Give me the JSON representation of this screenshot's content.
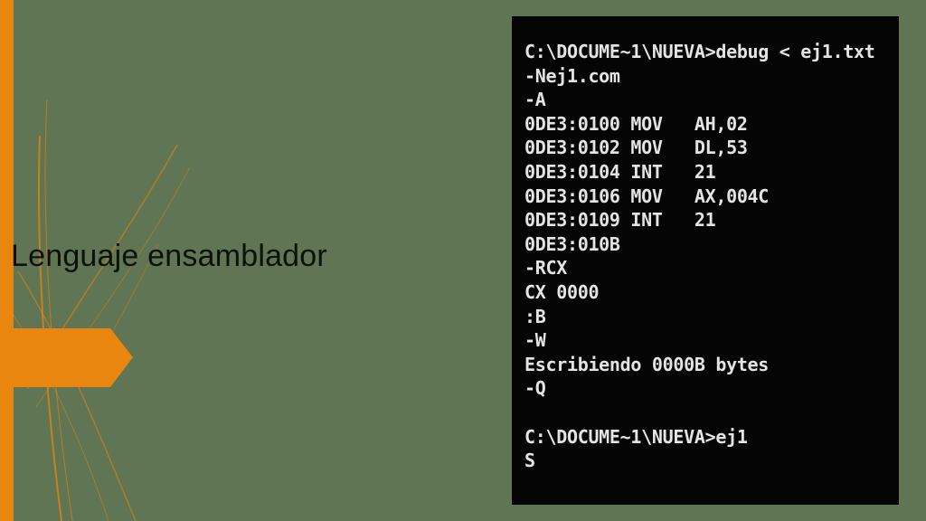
{
  "slide": {
    "title": "Lenguaje ensamblador",
    "colors": {
      "background": "#5f7553",
      "accent": "#e8860f",
      "console_background": "#050505",
      "console_text": "#e4e4e4"
    }
  },
  "console": {
    "lines": [
      "C:\\DOCUME~1\\NUEVA>debug < ej1.txt",
      "-Nej1.com",
      "-A",
      "0DE3:0100 MOV   AH,02",
      "0DE3:0102 MOV   DL,53",
      "0DE3:0104 INT   21",
      "0DE3:0106 MOV   AX,004C",
      "0DE3:0109 INT   21",
      "0DE3:010B",
      "-RCX",
      "CX 0000",
      ":B",
      "-W",
      "Escribiendo 0000B bytes",
      "-Q",
      "",
      "C:\\DOCUME~1\\NUEVA>ej1",
      "S"
    ]
  }
}
